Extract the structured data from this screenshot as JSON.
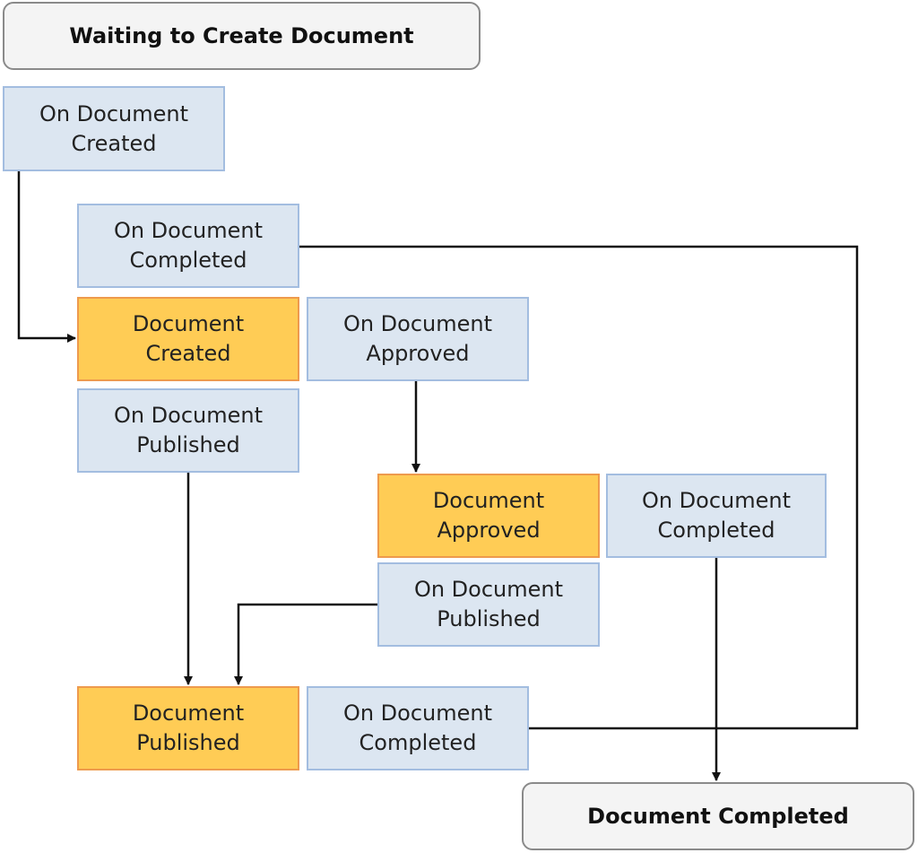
{
  "colors": {
    "event_fill": "#dce6f1",
    "event_border": "#a3bde0",
    "state_fill": "#ffcc55",
    "state_border": "#ee9a4d",
    "terminal_fill": "#f4f4f4"
  },
  "start_state": "Waiting to Create Document",
  "end_state": "Document Completed",
  "boxes": {
    "on_created": [
      "On Document",
      "Created"
    ],
    "on_completed_1": [
      "On Document",
      "Completed"
    ],
    "doc_created": [
      "Document",
      "Created"
    ],
    "on_approved": [
      "On Document",
      "Approved"
    ],
    "on_published_1": [
      "On Document",
      "Published"
    ],
    "doc_approved": [
      "Document",
      "Approved"
    ],
    "on_completed_2": [
      "On Document",
      "Completed"
    ],
    "on_published_2": [
      "On Document",
      "Published"
    ],
    "doc_published": [
      "Document",
      "Published"
    ],
    "on_completed_3": [
      "On Document",
      "Completed"
    ]
  }
}
